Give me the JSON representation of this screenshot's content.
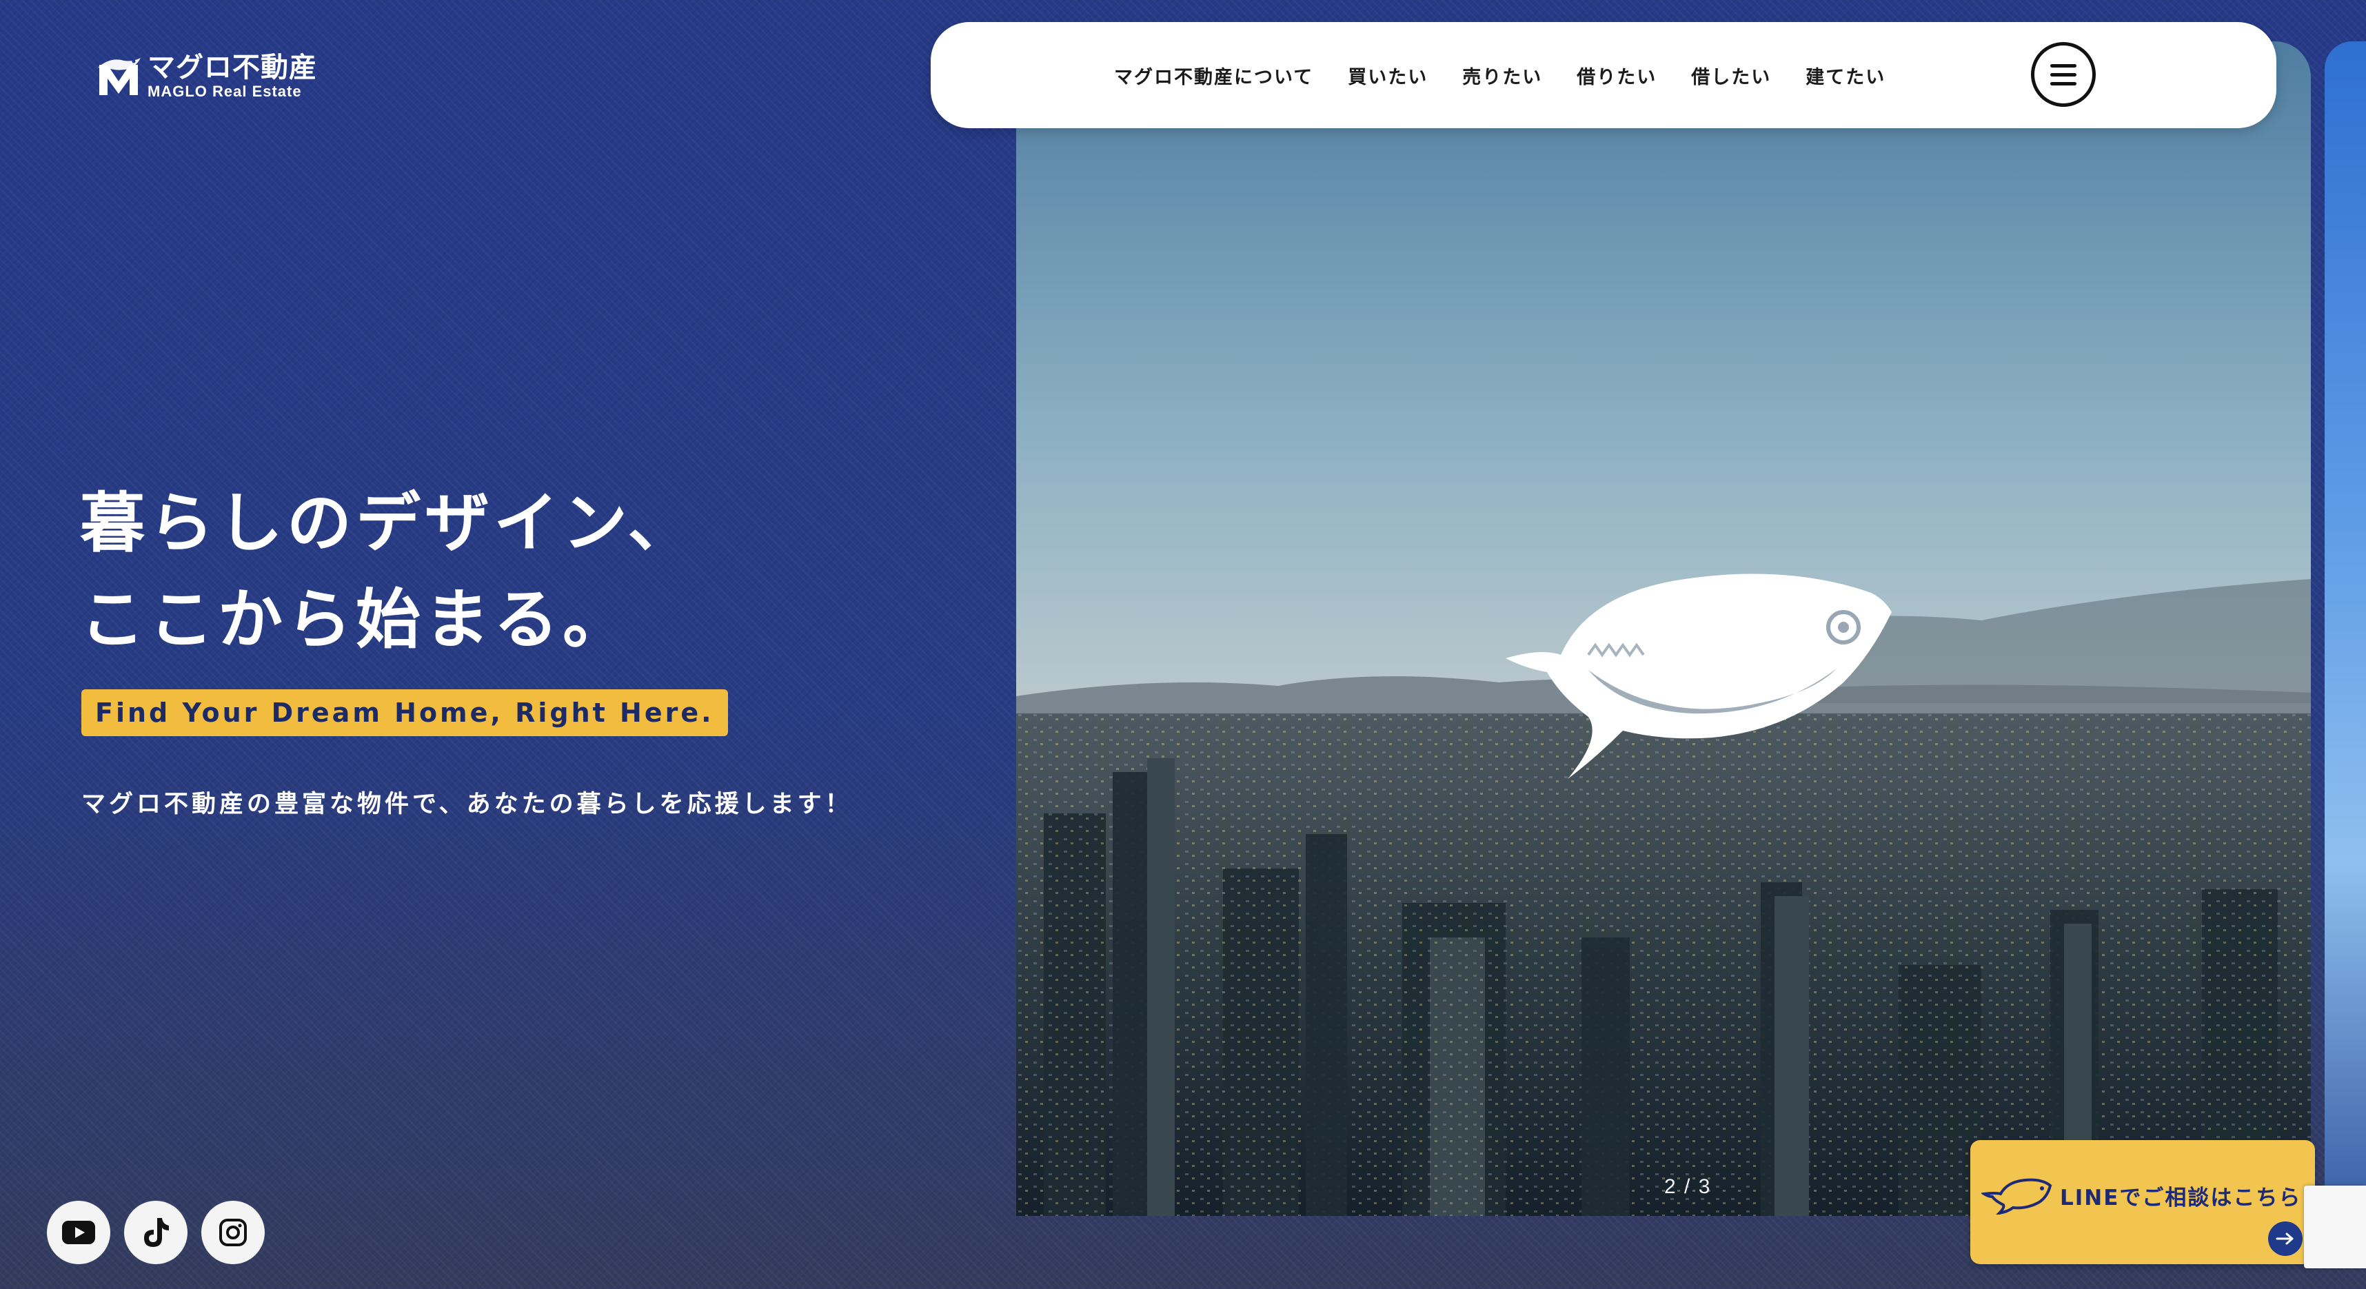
{
  "brand": {
    "name_jp": "マグロ不動産",
    "name_en": "MAGLO Real Estate"
  },
  "nav": {
    "links": [
      {
        "label": "マグロ不動産について"
      },
      {
        "label": "買いたい"
      },
      {
        "label": "売りたい"
      },
      {
        "label": "借りたい"
      },
      {
        "label": "借したい"
      },
      {
        "label": "建てたい"
      }
    ],
    "menu_icon": "hamburger-menu-icon"
  },
  "hero": {
    "title_line1": "暮らしのデザイン、",
    "title_line2": "ここから始まる。",
    "tagline": "Find Your Dream Home, Right Here.",
    "subtitle": "マグロ不動産の豊富な物件で、あなたの暮らしを応援します！"
  },
  "slider": {
    "counter": "2 / 3",
    "current": 2,
    "total": 3
  },
  "social": [
    {
      "name": "youtube-icon"
    },
    {
      "name": "tiktok-icon"
    },
    {
      "name": "instagram-icon"
    }
  ],
  "line_cta": {
    "label": "LINEでご相談はこちら",
    "icon": "arrow-right-icon"
  },
  "colors": {
    "background": "#273a86",
    "accent_yellow": "#f2bd3e",
    "nav_bg": "#ffffff",
    "cta_yellow": "#f2c450",
    "cta_text": "#1c2a78"
  }
}
